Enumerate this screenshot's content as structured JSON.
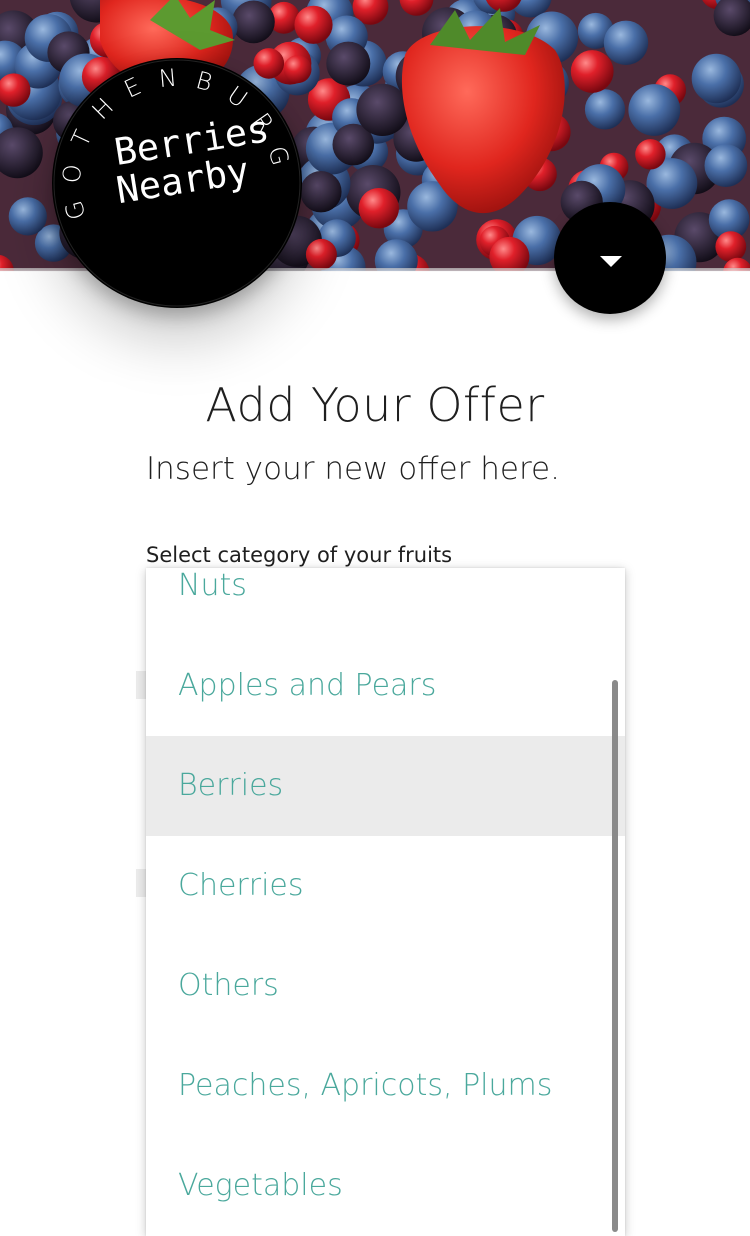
{
  "logo": {
    "line1": "Berries",
    "line2": "Nearby",
    "city": "GOTHENBURG"
  },
  "header": {
    "menu_icon": "caret-down-icon"
  },
  "form": {
    "title": "Add Your Offer",
    "subtitle": "Insert your new offer here.",
    "category_label": "Select category of your fruits"
  },
  "category_dropdown": {
    "options": [
      "Nuts",
      "Apples and Pears",
      "Berries",
      "Cherries",
      "Others",
      "Peaches, Apricots, Plums",
      "Vegetables"
    ],
    "highlighted": "Berries"
  },
  "colors": {
    "option_text": "#4aa89c",
    "highlight_bg": "#ebebeb",
    "badge": "#000000"
  }
}
